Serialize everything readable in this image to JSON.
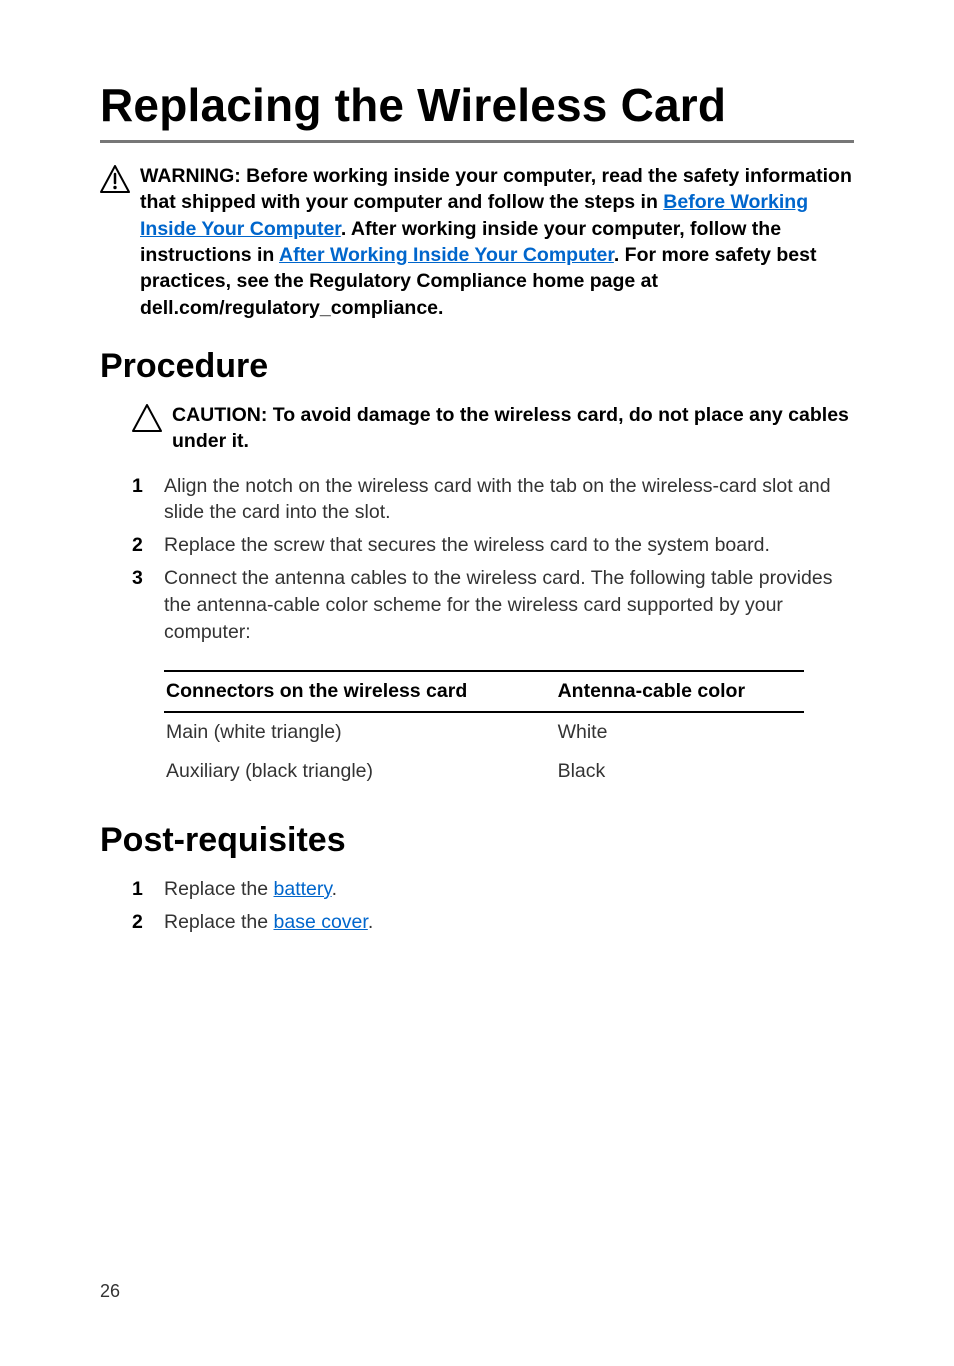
{
  "title": "Replacing the Wireless Card",
  "warning": {
    "pre": "WARNING: Before working inside your computer, read the safety information that shipped with your computer and follow the steps in ",
    "link1": "Before Working Inside Your Computer",
    "mid1": ". After working inside your computer, follow the instructions in ",
    "link2": "After Working Inside Your Computer",
    "post": ". For more safety best practices, see the Regulatory Compliance home page at dell.com/regulatory_compliance."
  },
  "procedure": {
    "heading": "Procedure",
    "caution": "CAUTION: To avoid damage to the wireless card, do not place any cables under it.",
    "steps": [
      "Align the notch on the wireless card with the tab on the wireless-card slot and slide the card into the slot.",
      "Replace the screw that secures the wireless card to the system board.",
      "Connect the antenna cables to the wireless card. The following table provides the antenna-cable color scheme for the wireless card supported by your computer:"
    ],
    "table": {
      "header": {
        "col1": "Connectors on the wireless card",
        "col2": "Antenna-cable color"
      },
      "rows": [
        {
          "c1": "Main (white triangle)",
          "c2": "White"
        },
        {
          "c1": "Auxiliary (black triangle)",
          "c2": "Black"
        }
      ]
    }
  },
  "postreq": {
    "heading": "Post-requisites",
    "steps": [
      {
        "pre": "Replace the ",
        "link": "battery",
        "post": "."
      },
      {
        "pre": "Replace the ",
        "link": "base cover",
        "post": "."
      }
    ]
  },
  "page_number": "26"
}
